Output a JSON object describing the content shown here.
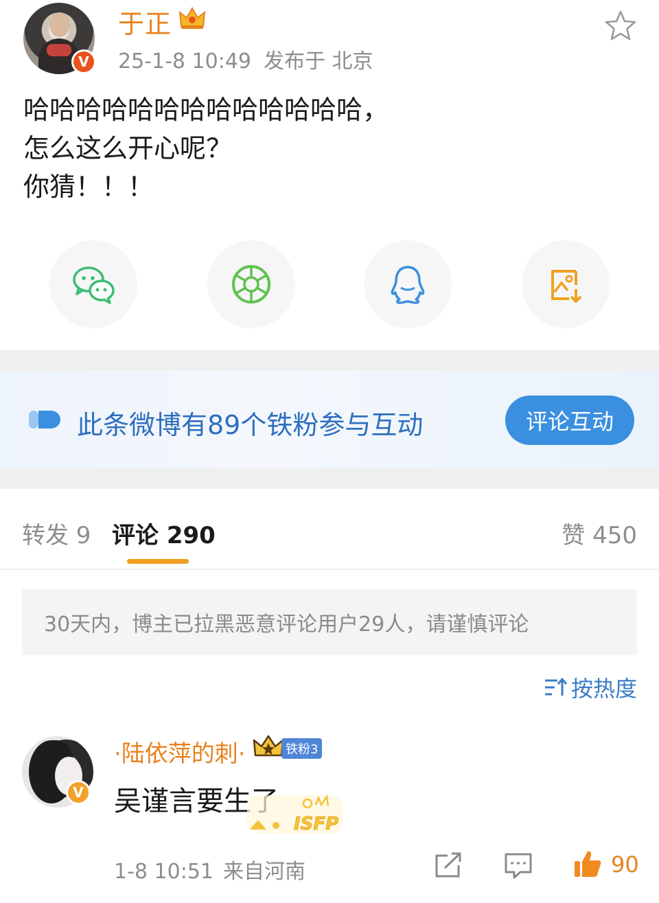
{
  "post": {
    "author": "于正",
    "date": "25-1-8 10:49",
    "location": "发布于 北京",
    "verified_mark": "V",
    "text_lines": [
      "哈哈哈哈哈哈哈哈哈哈哈哈哈，",
      "怎么这么开心呢？",
      "你猜！！！"
    ]
  },
  "share": {
    "icons": [
      "wechat-icon",
      "moments-icon",
      "qq-icon",
      "save-image-icon"
    ],
    "colors": {
      "wechat": "#3cbd74",
      "moments": "#5fc24f",
      "qq": "#3a8fe0",
      "save": "#f0a020"
    }
  },
  "fans_banner": {
    "text": "此条微博有89个铁粉参与互动",
    "button": "评论互动"
  },
  "tabs": {
    "repost": "转发 9",
    "comment": "评论 290",
    "like": "赞 450"
  },
  "notice": "30天内，博主已拉黑恶意评论用户29人，请谨慎评论",
  "sort": {
    "label": "按热度"
  },
  "comment": {
    "name": "·陆依萍的刺·",
    "fan_badge": "铁粉3",
    "verified_mark": "V",
    "text": "吴谨言要生了",
    "deco_text": "ISFP",
    "date": "1-8 10:51",
    "source": "来自河南",
    "like_count": "90"
  },
  "colors": {
    "accent_orange": "#e8821e",
    "link_blue": "#3a7cc8",
    "button_blue": "#3a8fe0",
    "tab_underline": "#f0a020"
  }
}
